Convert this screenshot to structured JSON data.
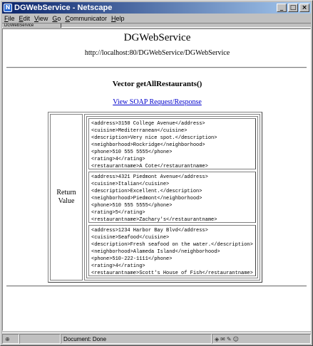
{
  "window": {
    "title": "DGWebService - Netscape"
  },
  "menu": [
    "File",
    "Edit",
    "View",
    "Go",
    "Communicator",
    "Help"
  ],
  "location_tab": "DGWebService",
  "page": {
    "title": "DGWebService",
    "endpoint": "http://localhost:80/DGWebService/DGWebService",
    "method": "Vector getAllRestaurants()",
    "soap_link": "View SOAP Request/Response",
    "return_label_line1": "Return",
    "return_label_line2": "Value"
  },
  "records": [
    [
      "<address>3150 College Avenue</address>",
      "<cuisine>Mediterranean</cuisine>",
      "<description>Very nice spot.</description>",
      "<neighborhood>Rockridge</neighborhood>",
      "<phone>510 555 5555</phone>",
      "<rating>4</rating>",
      "<restaurantname>A Cote</restaurantname>"
    ],
    [
      "<address>4321 Piedmont Avenue</address>",
      "<cuisine>Italian</cuisine>",
      "<description>Excellent.</description>",
      "<neighborhood>Piedmont</neighborhood>",
      "<phone>510 555 5555</phone>",
      "<rating>5</rating>",
      "<restaurantname>Zachary's</restaurantname>"
    ],
    [
      "<address>1234 Harbor Bay Blvd</address>",
      "<cuisine>Seafood</cuisine>",
      "<description>Fresh seafood on the water.</description>",
      "<neighborhood>Alameda Island</neighborhood>",
      "<phone>510-222-1111</phone>",
      "<rating>4</rating>",
      "<restaurantname>Scott's House of Fish</restaurantname>"
    ]
  ],
  "status": {
    "text": "Document: Done"
  },
  "icons": {
    "app": "netscape-icon",
    "minimize": "minimize-icon",
    "maximize": "maximize-icon",
    "close": "close-icon"
  }
}
